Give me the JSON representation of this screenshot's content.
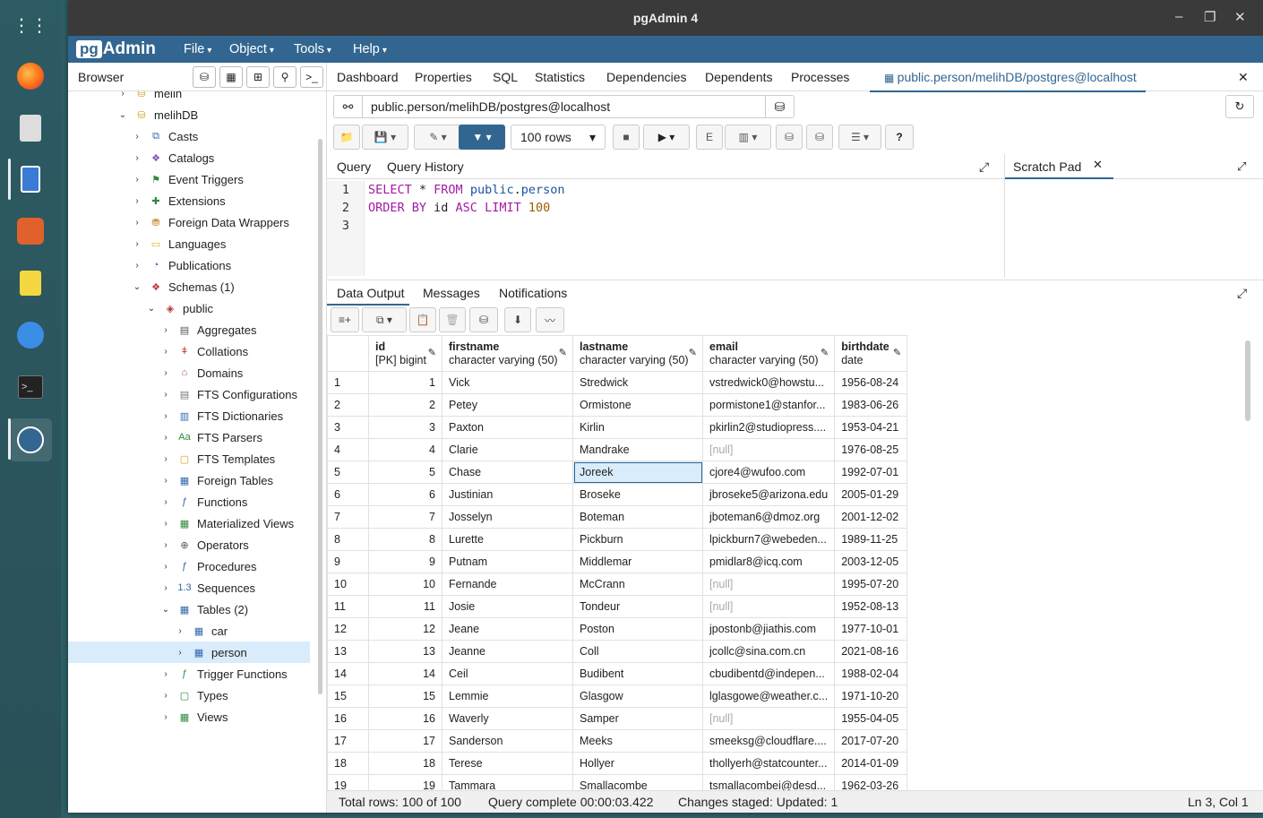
{
  "window": {
    "title": "pgAdmin 4",
    "minimize": "–",
    "maximize": "❐",
    "close": "✕"
  },
  "menubar": {
    "logo_a": "pg",
    "logo_b": "Admin",
    "items": [
      "File",
      "Object",
      "Tools",
      "Help"
    ]
  },
  "browser": {
    "label": "Browser"
  },
  "tree": [
    {
      "label": "melih",
      "level": 0,
      "chev": "›",
      "icon": "db"
    },
    {
      "label": "melihDB",
      "level": 0,
      "chev": "⌄",
      "icon": "db"
    },
    {
      "label": "Casts",
      "level": 1,
      "chev": "›",
      "icon": "casts"
    },
    {
      "label": "Catalogs",
      "level": 1,
      "chev": "›",
      "icon": "catalogs"
    },
    {
      "label": "Event Triggers",
      "level": 1,
      "chev": "›",
      "icon": "event-trigger"
    },
    {
      "label": "Extensions",
      "level": 1,
      "chev": "›",
      "icon": "extension"
    },
    {
      "label": "Foreign Data Wrappers",
      "level": 1,
      "chev": "›",
      "icon": "fdw"
    },
    {
      "label": "Languages",
      "level": 1,
      "chev": "›",
      "icon": "language"
    },
    {
      "label": "Publications",
      "level": 1,
      "chev": "›",
      "icon": "publication"
    },
    {
      "label": "Schemas (1)",
      "level": 1,
      "chev": "⌄",
      "icon": "schemas"
    },
    {
      "label": "public",
      "level": 2,
      "chev": "⌄",
      "icon": "schema"
    },
    {
      "label": "Aggregates",
      "level": 3,
      "chev": "›",
      "icon": "aggregate"
    },
    {
      "label": "Collations",
      "level": 3,
      "chev": "›",
      "icon": "collation"
    },
    {
      "label": "Domains",
      "level": 3,
      "chev": "›",
      "icon": "domain"
    },
    {
      "label": "FTS Configurations",
      "level": 3,
      "chev": "›",
      "icon": "fts-config"
    },
    {
      "label": "FTS Dictionaries",
      "level": 3,
      "chev": "›",
      "icon": "fts-dict"
    },
    {
      "label": "FTS Parsers",
      "level": 3,
      "chev": "›",
      "icon": "fts-parser"
    },
    {
      "label": "FTS Templates",
      "level": 3,
      "chev": "›",
      "icon": "fts-template"
    },
    {
      "label": "Foreign Tables",
      "level": 3,
      "chev": "›",
      "icon": "foreign-table"
    },
    {
      "label": "Functions",
      "level": 3,
      "chev": "›",
      "icon": "function"
    },
    {
      "label": "Materialized Views",
      "level": 3,
      "chev": "›",
      "icon": "mview"
    },
    {
      "label": "Operators",
      "level": 3,
      "chev": "›",
      "icon": "operator"
    },
    {
      "label": "Procedures",
      "level": 3,
      "chev": "›",
      "icon": "procedure"
    },
    {
      "label": "Sequences",
      "level": 3,
      "chev": "›",
      "icon": "sequence"
    },
    {
      "label": "Tables (2)",
      "level": 3,
      "chev": "⌄",
      "icon": "tables"
    },
    {
      "label": "car",
      "level": 4,
      "chev": "›",
      "icon": "table"
    },
    {
      "label": "person",
      "level": 4,
      "chev": "›",
      "icon": "table",
      "selected": true
    },
    {
      "label": "Trigger Functions",
      "level": 3,
      "chev": "›",
      "icon": "trigger-function"
    },
    {
      "label": "Types",
      "level": 3,
      "chev": "›",
      "icon": "type"
    },
    {
      "label": "Views",
      "level": 3,
      "chev": "›",
      "icon": "view"
    }
  ],
  "tabs": [
    "Dashboard",
    "Properties",
    "SQL",
    "Statistics",
    "Dependencies",
    "Dependents",
    "Processes"
  ],
  "active_tab": "public.person/melihDB/postgres@localhost",
  "connection": "public.person/melihDB/postgres@localhost",
  "rows_limit": "100 rows",
  "query_tabs": {
    "query": "Query",
    "history": "Query History",
    "scratch": "Scratch Pad"
  },
  "editor": {
    "lines": [
      "1",
      "2",
      "3"
    ]
  },
  "output_tabs": [
    "Data Output",
    "Messages",
    "Notifications"
  ],
  "columns": [
    {
      "name": "id",
      "type": "[PK] bigint"
    },
    {
      "name": "firstname",
      "type": "character varying (50)"
    },
    {
      "name": "lastname",
      "type": "character varying (50)"
    },
    {
      "name": "email",
      "type": "character varying (50)"
    },
    {
      "name": "birthdate",
      "type": "date"
    }
  ],
  "rows": [
    [
      "1",
      "1",
      "Vick",
      "Stredwick",
      "vstredwick0@howstu...",
      "1956-08-24"
    ],
    [
      "2",
      "2",
      "Petey",
      "Ormistone",
      "pormistone1@stanfor...",
      "1983-06-26"
    ],
    [
      "3",
      "3",
      "Paxton",
      "Kirlin",
      "pkirlin2@studiopress....",
      "1953-04-21"
    ],
    [
      "4",
      "4",
      "Clarie",
      "Mandrake",
      "[null]",
      "1976-08-25"
    ],
    [
      "5",
      "5",
      "Chase",
      "Joreek",
      "cjore4@wufoo.com",
      "1992-07-01"
    ],
    [
      "6",
      "6",
      "Justinian",
      "Broseke",
      "jbroseke5@arizona.edu",
      "2005-01-29"
    ],
    [
      "7",
      "7",
      "Josselyn",
      "Boteman",
      "jboteman6@dmoz.org",
      "2001-12-02"
    ],
    [
      "8",
      "8",
      "Lurette",
      "Pickburn",
      "lpickburn7@webeden...",
      "1989-11-25"
    ],
    [
      "9",
      "9",
      "Putnam",
      "Middlemar",
      "pmidlar8@icq.com",
      "2003-12-05"
    ],
    [
      "10",
      "10",
      "Fernande",
      "McCrann",
      "[null]",
      "1995-07-20"
    ],
    [
      "11",
      "11",
      "Josie",
      "Tondeur",
      "[null]",
      "1952-08-13"
    ],
    [
      "12",
      "12",
      "Jeane",
      "Poston",
      "jpostonb@jiathis.com",
      "1977-10-01"
    ],
    [
      "13",
      "13",
      "Jeanne",
      "Coll",
      "jcollc@sina.com.cn",
      "2021-08-16"
    ],
    [
      "14",
      "14",
      "Ceil",
      "Budibent",
      "cbudibentd@indepen...",
      "1988-02-04"
    ],
    [
      "15",
      "15",
      "Lemmie",
      "Glasgow",
      "lglasgowe@weather.c...",
      "1971-10-20"
    ],
    [
      "16",
      "16",
      "Waverly",
      "Samper",
      "[null]",
      "1955-04-05"
    ],
    [
      "17",
      "17",
      "Sanderson",
      "Meeks",
      "smeeksg@cloudflare....",
      "2017-07-20"
    ],
    [
      "18",
      "18",
      "Terese",
      "Hollyer",
      "thollyerh@statcounter...",
      "2014-01-09"
    ],
    [
      "19",
      "19",
      "Tammara",
      "Smallacombe",
      "tsmallacombei@desd...",
      "1962-03-26"
    ]
  ],
  "status": {
    "total": "Total rows: 100 of 100",
    "query": "Query complete 00:00:03.422",
    "changes": "Changes staged: Updated: 1",
    "pos": "Ln 3, Col 1"
  },
  "colors": {
    "accent": "#326690",
    "titlebar": "#3a3a3a",
    "selection": "#d9ecfb"
  }
}
